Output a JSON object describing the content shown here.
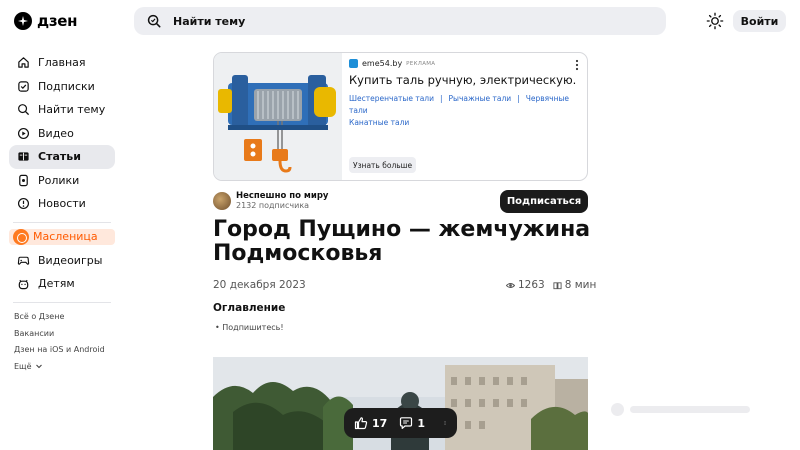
{
  "header": {
    "logo_text": "дзен",
    "search_placeholder": "Найти тему",
    "login_label": "Войти"
  },
  "sidebar": {
    "items": [
      {
        "label": "Главная",
        "icon": "home-icon"
      },
      {
        "label": "Подписки",
        "icon": "subscriptions-icon"
      },
      {
        "label": "Найти тему",
        "icon": "find-topic-icon"
      },
      {
        "label": "Видео",
        "icon": "video-icon"
      },
      {
        "label": "Статьи",
        "icon": "articles-icon",
        "active": true
      },
      {
        "label": "Ролики",
        "icon": "shorts-icon"
      },
      {
        "label": "Новости",
        "icon": "news-icon"
      }
    ],
    "promo_label": "Масленица",
    "extra_items": [
      {
        "label": "Видеоигры",
        "icon": "gamepad-icon"
      },
      {
        "label": "Детям",
        "icon": "kids-icon"
      }
    ],
    "footer_links": [
      "Всё о Дзене",
      "Вакансии",
      "Дзен на iOS и Android",
      "Ещё"
    ]
  },
  "ad": {
    "source": "eme54.by",
    "tag": "Реклама",
    "title": "Купить таль ручную, электрическую.",
    "links": [
      "Шестеренчатые тали",
      "Рычажные тали",
      "Червячные тали",
      "Канатные тали"
    ],
    "separator": "|",
    "cta": "Узнать больше"
  },
  "author": {
    "name": "Неспешно по миру",
    "subscribers": "2132 подписчика",
    "subscribe_label": "Подписаться"
  },
  "article": {
    "title": "Город Пущино — жемчужина Подмосковья",
    "date": "20 декабря 2023",
    "views": "1263",
    "read_time": "8 мин",
    "toc_heading": "Оглавление",
    "toc_items": [
      "• Подпишитесь!"
    ]
  },
  "reactions": {
    "likes": "17",
    "comments": "1"
  },
  "colors": {
    "accent_promo": "#ff5a00",
    "dark_button": "#1b1b1b",
    "link_blue": "#2a67c9"
  }
}
